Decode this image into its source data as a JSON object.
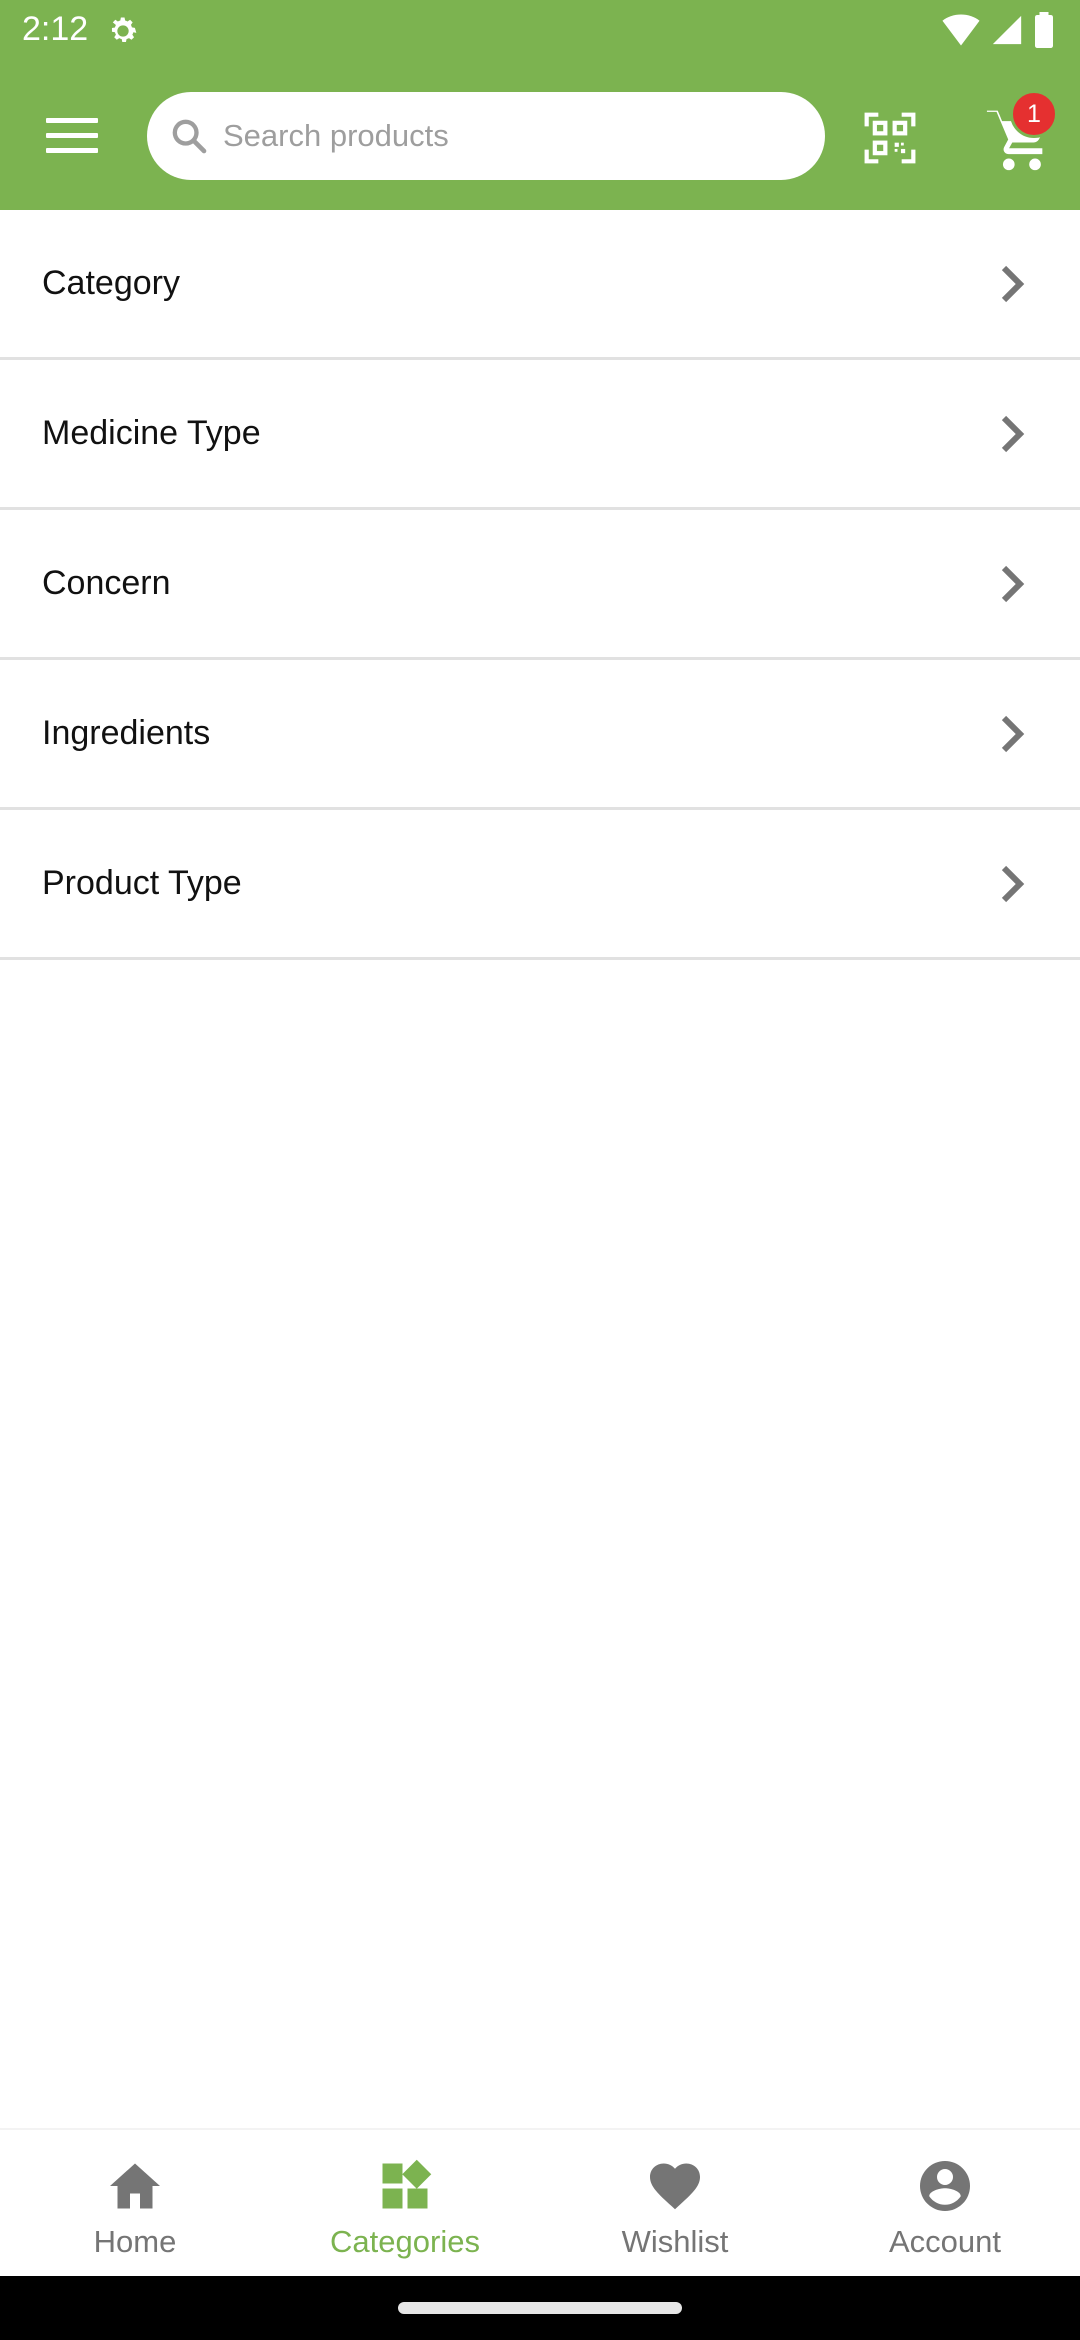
{
  "status_bar": {
    "time": "2:12",
    "icons": [
      "settings-gear-icon",
      "wifi-icon",
      "cell-signal-icon",
      "battery-icon"
    ]
  },
  "app_bar": {
    "menu_icon": "hamburger-menu-icon",
    "search": {
      "placeholder": "Search products",
      "value": "",
      "icon": "search-icon"
    },
    "scan_icon": "qr-scan-icon",
    "cart": {
      "icon": "cart-icon",
      "badge_count": "1"
    }
  },
  "colors": {
    "brand": "#7cb350",
    "badge": "#e53030",
    "inactive": "#757575"
  },
  "filter_list": {
    "items": [
      {
        "label": "Category"
      },
      {
        "label": "Medicine Type"
      },
      {
        "label": "Concern"
      },
      {
        "label": "Ingredients"
      },
      {
        "label": "Product Type"
      }
    ]
  },
  "bottom_nav": {
    "active": "Categories",
    "items": [
      {
        "label": "Home",
        "icon": "home-icon"
      },
      {
        "label": "Categories",
        "icon": "categories-icon"
      },
      {
        "label": "Wishlist",
        "icon": "heart-icon"
      },
      {
        "label": "Account",
        "icon": "account-icon"
      }
    ]
  }
}
